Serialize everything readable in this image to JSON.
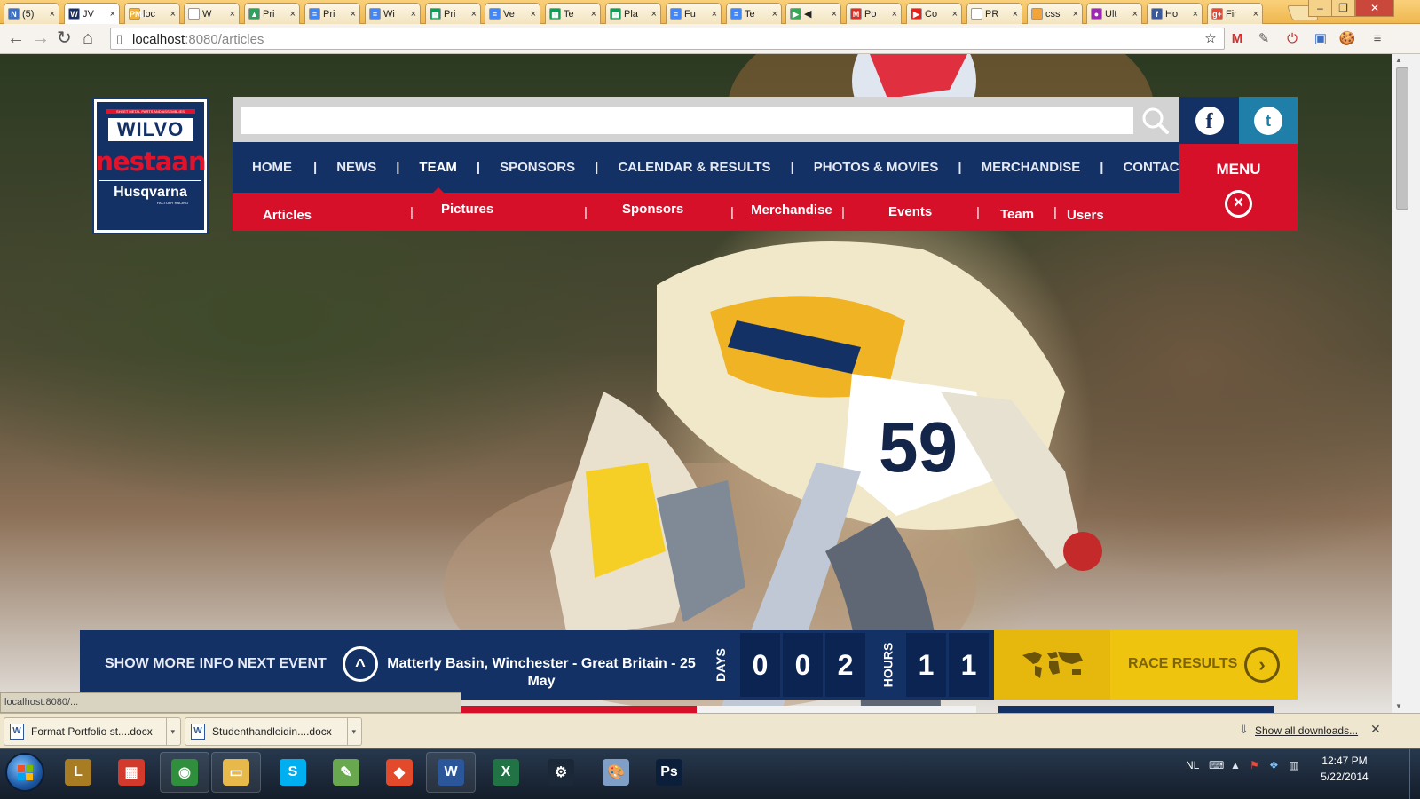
{
  "browser": {
    "tabs": [
      {
        "label": "(5)",
        "color": "#3b6fc4",
        "glyph": "N"
      },
      {
        "label": "JV",
        "color": "#1a2e66",
        "glyph": "W",
        "active": true
      },
      {
        "label": "loc",
        "color": "#f2b233",
        "glyph": "PMA"
      },
      {
        "label": "W",
        "color": "#ffffff",
        "glyph": ""
      },
      {
        "label": "Pri",
        "color": "#2e9f5c",
        "glyph": "▲"
      },
      {
        "label": "Pri",
        "color": "#4285f4",
        "glyph": "≡"
      },
      {
        "label": "Wi",
        "color": "#4285f4",
        "glyph": "≡"
      },
      {
        "label": "Pri",
        "color": "#0f9d58",
        "glyph": "▦"
      },
      {
        "label": "Ve",
        "color": "#4285f4",
        "glyph": "≡"
      },
      {
        "label": "Te",
        "color": "#0f9d58",
        "glyph": "▦"
      },
      {
        "label": "Pla",
        "color": "#0f9d58",
        "glyph": "▦"
      },
      {
        "label": "Fu",
        "color": "#4285f4",
        "glyph": "≡"
      },
      {
        "label": "Te",
        "color": "#4285f4",
        "glyph": "≡"
      },
      {
        "label": "◀",
        "color": "#34a853",
        "glyph": "▶"
      },
      {
        "label": "Po",
        "color": "#d93025",
        "glyph": "M"
      },
      {
        "label": "Co",
        "color": "#e62117",
        "glyph": "▶"
      },
      {
        "label": "PR",
        "color": "#ffffff",
        "glyph": ""
      },
      {
        "label": "css",
        "color": "#f2a33a",
        "glyph": ""
      },
      {
        "label": "Ult",
        "color": "#9c27b0",
        "glyph": "●"
      },
      {
        "label": "Ho",
        "color": "#3b5998",
        "glyph": "f"
      },
      {
        "label": "Fir",
        "color": "#dd4b39",
        "glyph": "g+"
      }
    ],
    "url_host": "localhost",
    "url_path": ":8080/articles",
    "extensions": [
      "☆",
      "M",
      "✎",
      "⏻",
      "▣",
      "🍪",
      "≡"
    ]
  },
  "site": {
    "logo": {
      "top_line": "SHEET METAL PARTS AND ASSEMBLIES",
      "wilvo": "WILVO",
      "nestaan": "nestaan",
      "husqvarna": "Husqvarna",
      "factory": "FACTORY RACING"
    },
    "search": {
      "placeholder": "",
      "value": ""
    },
    "social": {
      "facebook": "f",
      "twitter": "t"
    },
    "menu_label": "MENU",
    "main_nav": [
      "HOME",
      "NEWS",
      "TEAM",
      "SPONSORS",
      "CALENDAR & RESULTS",
      "PHOTOS & MOVIES",
      "MERCHANDISE",
      "CONTACT"
    ],
    "active_nav": "TEAM",
    "sub_nav": [
      "Articles",
      "Pictures",
      "Sponsors",
      "Merchandise",
      "Events",
      "Team",
      "Users"
    ],
    "event": {
      "more_label": "SHOW MORE INFO NEXT EVENT",
      "name": "Matterly Basin, Winchester - Great Britain - 25 May",
      "days_label": "DAYS",
      "days_digits": [
        "0",
        "0",
        "2"
      ],
      "hours_label": "HOURS",
      "hours_digits": [
        "1",
        "1"
      ],
      "results_label": "RACE RESULTS"
    },
    "status_text": "localhost:8080/..."
  },
  "downloads": {
    "items": [
      {
        "name": "Format Portfolio st....docx",
        "icon": "W"
      },
      {
        "name": "Studenthandleidin....docx",
        "icon": "W"
      }
    ],
    "show_all": "Show all downloads..."
  },
  "taskbar": {
    "apps": [
      {
        "name": "league-of-legends",
        "glyph": "L",
        "bg": "#a77c22"
      },
      {
        "name": "metro",
        "glyph": "▦",
        "bg": "#d23a2b"
      },
      {
        "name": "chrome",
        "glyph": "◉",
        "bg": "#2f8f3d"
      },
      {
        "name": "explorer",
        "glyph": "▭",
        "bg": "#e7b84a"
      },
      {
        "name": "skype",
        "glyph": "S",
        "bg": "#00aff0"
      },
      {
        "name": "notepad",
        "glyph": "✎",
        "bg": "#6aa84f"
      },
      {
        "name": "git",
        "glyph": "◆",
        "bg": "#e24a2b"
      },
      {
        "name": "word",
        "glyph": "W",
        "bg": "#2b579a"
      },
      {
        "name": "excel",
        "glyph": "X",
        "bg": "#217346"
      },
      {
        "name": "steam",
        "glyph": "⚙",
        "bg": "#1b2838"
      },
      {
        "name": "paint",
        "glyph": "🎨",
        "bg": "#7f9fc7"
      },
      {
        "name": "photoshop",
        "glyph": "Ps",
        "bg": "#0b1f3a"
      }
    ],
    "language": "NL",
    "time": "12:47 PM",
    "date": "5/22/2014"
  }
}
